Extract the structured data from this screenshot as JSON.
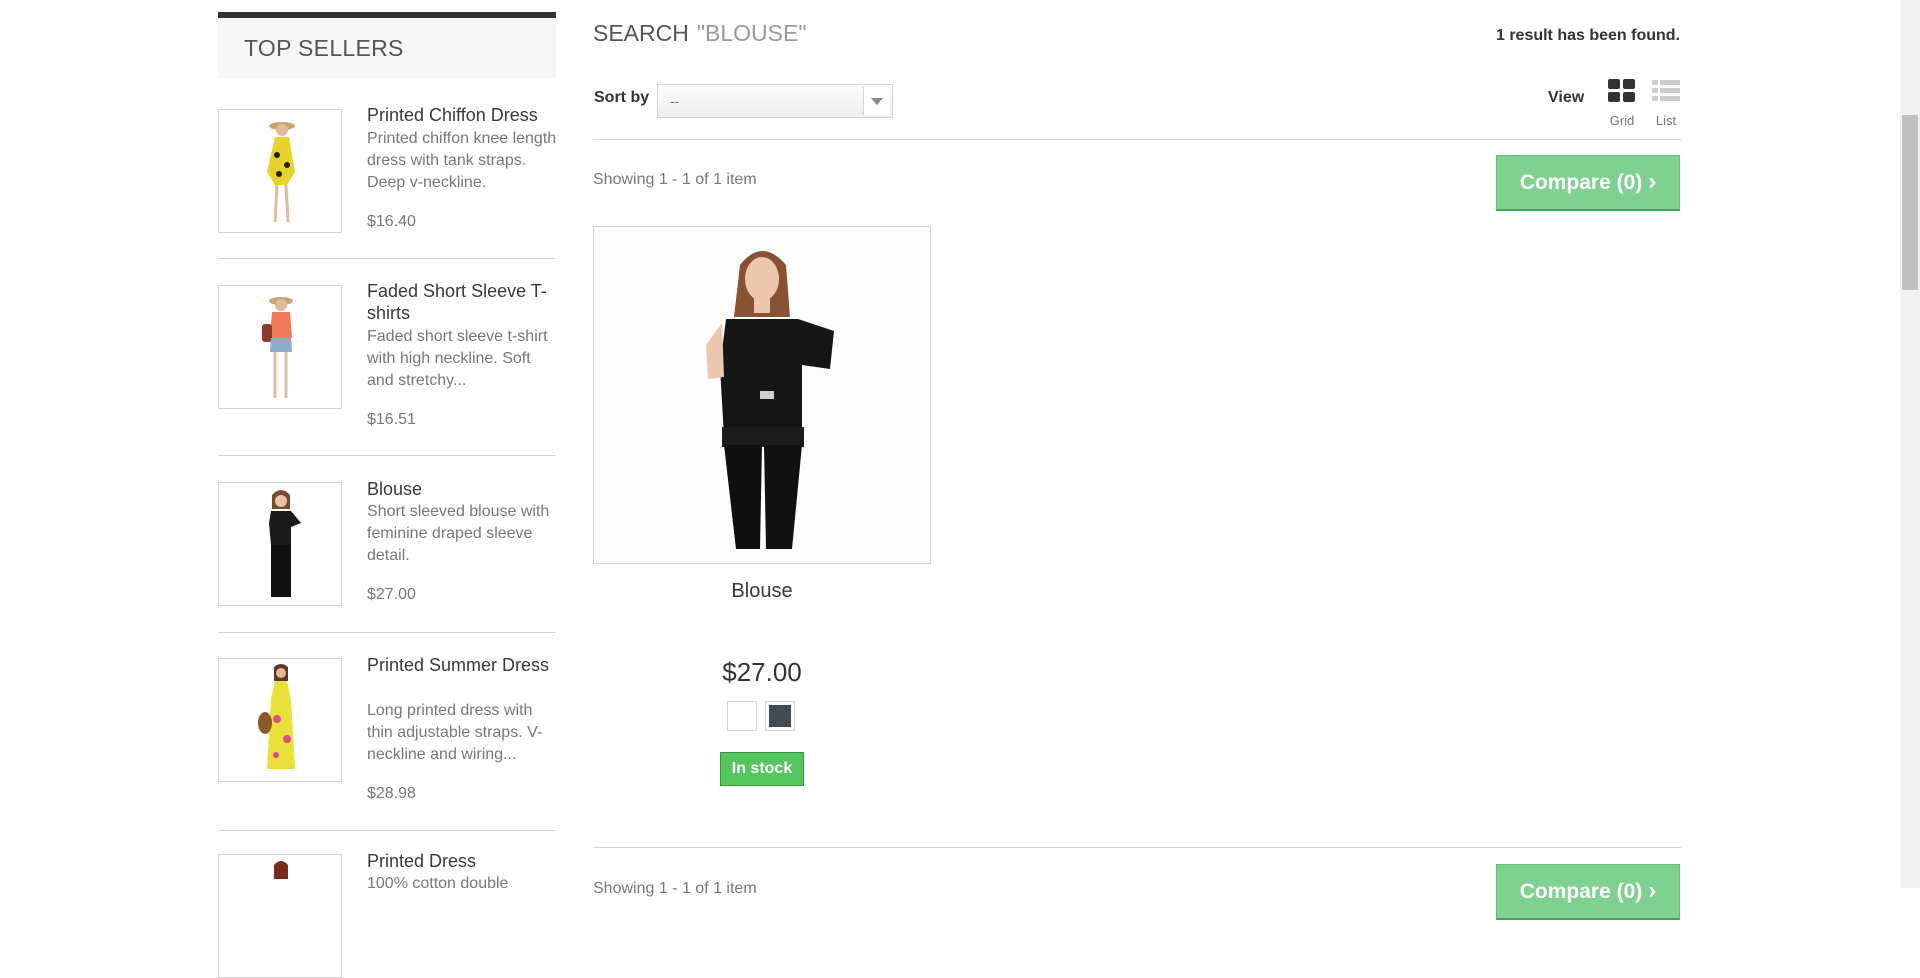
{
  "sidebar": {
    "title": "TOP SELLERS",
    "items": [
      {
        "name": "Printed Chiffon Dress",
        "desc": "Printed chiffon knee length dress with tank straps. Deep v-neckline.",
        "price": "$16.40"
      },
      {
        "name": "Faded Short Sleeve T-shirts",
        "desc": "Faded short sleeve t-shirt with high neckline. Soft and stretchy...",
        "price": "$16.51"
      },
      {
        "name": "Blouse",
        "desc": "Short sleeved blouse with feminine draped sleeve detail.",
        "price": "$27.00"
      },
      {
        "name": "Printed Summer Dress",
        "desc": "Long printed dress with thin adjustable straps. V-neckline and wiring...",
        "price": "$28.98"
      },
      {
        "name": "Printed Dress",
        "desc": "100% cotton double",
        "price": ""
      }
    ]
  },
  "main": {
    "heading_prefix": "SEARCH",
    "heading_query": "\"BLOUSE\"",
    "results_found": "1 result has been found.",
    "sort_label": "Sort by",
    "sort_value": "--",
    "view_label": "View",
    "view_grid": "Grid",
    "view_list": "List",
    "showing_top": "Showing 1 - 1 of 1 item",
    "showing_bottom": "Showing 1 - 1 of 1 item",
    "compare_label": "Compare (0)",
    "product": {
      "name": "Blouse",
      "price": "$27.00",
      "stock": "In stock",
      "colors": [
        "#ffffff",
        "#434a54"
      ]
    }
  }
}
